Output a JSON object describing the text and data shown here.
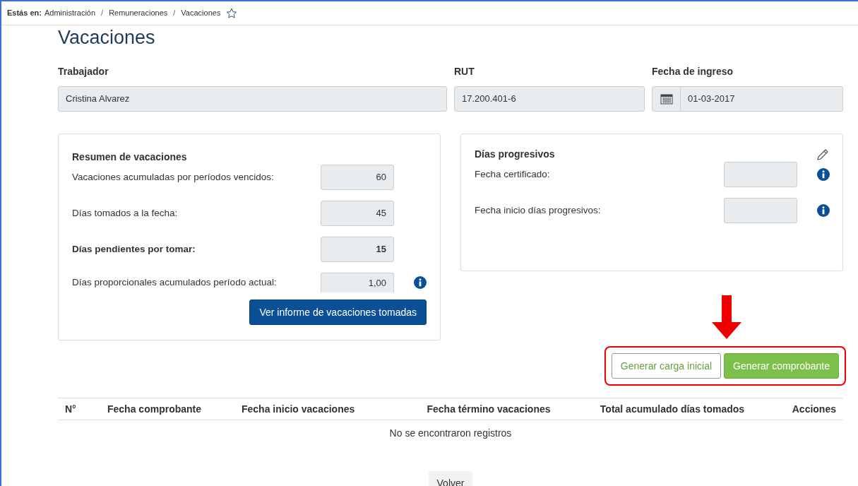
{
  "breadcrumb": {
    "prefix": "Estás en:",
    "items": [
      "Administración",
      "Remuneraciones",
      "Vacaciones"
    ],
    "separator": "/",
    "favorite": false
  },
  "title": "Vacaciones",
  "fields": [
    {
      "label": "Trabajador",
      "value": "Cristina Alvarez",
      "kind": "text"
    },
    {
      "label": "RUT",
      "value": "17.200.401-6",
      "kind": "text"
    },
    {
      "label": "Fecha de ingreso",
      "value": "01-03-2017",
      "kind": "date"
    }
  ],
  "summary": {
    "title": "Resumen de vacaciones",
    "rows": [
      {
        "label": "Vacaciones acumuladas por períodos vencidos:",
        "value": "60",
        "emphasized": false,
        "info": false
      },
      {
        "label": "Días tomados a la fecha:",
        "value": "45",
        "emphasized": false,
        "info": false
      },
      {
        "label": "Días pendientes por tomar:",
        "value": "15",
        "emphasized": true,
        "info": false
      },
      {
        "label": "Días proporcionales acumulados período actual:",
        "value": "1,00",
        "emphasized": false,
        "info": true
      }
    ],
    "button": "Ver informe de vacaciones tomadas"
  },
  "progressive": {
    "title": "Días progresivos",
    "rows": [
      {
        "label": "Fecha certificado:",
        "info": true
      },
      {
        "label": "Fecha inicio días progresivos:",
        "info": true
      }
    ]
  },
  "actions": [
    {
      "label": "Generar carga inicial",
      "kind": "outline"
    },
    {
      "label": "Generar comprobante",
      "kind": "primary"
    }
  ],
  "table": {
    "columns": [
      "N°",
      "Fecha comprobante",
      "Fecha inicio vacaciones",
      "Fecha término vacaciones",
      "Total acumulado días tomados",
      "Acciones"
    ],
    "empty": "No se encontraron registros"
  },
  "back_button": "Volver"
}
